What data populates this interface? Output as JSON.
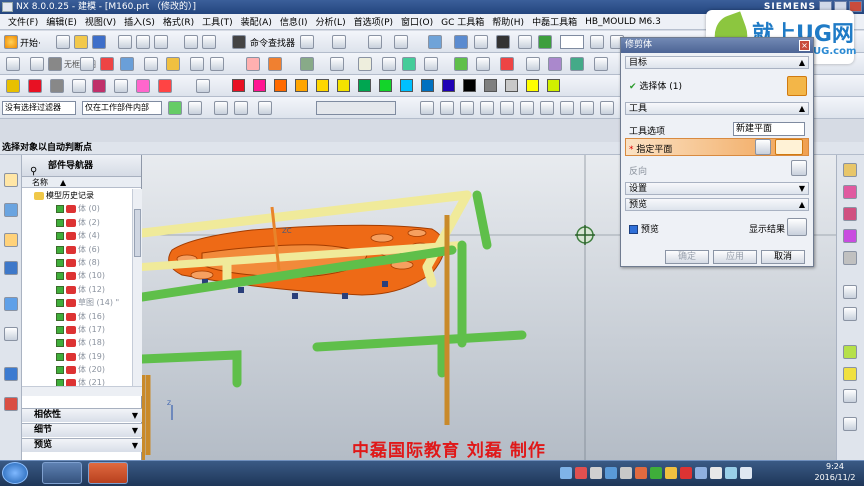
{
  "window": {
    "title": "NX 8.0.0.25 - 建模 - [M160.prt （修改的）]",
    "brand": "SIEMENS"
  },
  "menu": [
    "文件(F)",
    "编辑(E)",
    "视图(V)",
    "插入(S)",
    "格式(R)",
    "工具(T)",
    "装配(A)",
    "信息(I)",
    "分析(L)",
    "首选项(P)",
    "窗口(O)",
    "GC 工具箱",
    "帮助(H)",
    "中磊工具箱",
    "HB_MOULD M6.3"
  ],
  "toolbar": {
    "start_label": "开始·",
    "command_finder": "命令查找器",
    "datum_label": "无框草图",
    "filter_combo": "没有选择过滤器",
    "scope_combo": "仅在工作部件内部",
    "status": "选择对象以自动判断点"
  },
  "logo": {
    "name": "就上UG网",
    "url": "www.9SUG.com"
  },
  "navigator": {
    "title": "部件导航器",
    "col_name": "名称",
    "items": [
      {
        "label": "模型历史记录",
        "indent": 1
      },
      {
        "label": "体 (0)",
        "indent": 2
      },
      {
        "label": "体 (2)",
        "indent": 2
      },
      {
        "label": "体 (4)",
        "indent": 2
      },
      {
        "label": "体 (6)",
        "indent": 2
      },
      {
        "label": "体 (8)",
        "indent": 2
      },
      {
        "label": "体 (10)",
        "indent": 2
      },
      {
        "label": "体 (12)",
        "indent": 2
      },
      {
        "label": "草图 (14) \"",
        "indent": 2
      },
      {
        "label": "体 (16)",
        "indent": 2
      },
      {
        "label": "体 (17)",
        "indent": 2
      },
      {
        "label": "体 (18)",
        "indent": 2
      },
      {
        "label": "体 (19)",
        "indent": 2
      },
      {
        "label": "体 (20)",
        "indent": 2
      },
      {
        "label": "体 (21)",
        "indent": 2
      }
    ],
    "sections": [
      "相依性",
      "细节",
      "预览"
    ]
  },
  "dialog": {
    "title": "修剪体",
    "target_section": "目标",
    "select_body": "选择体 (1)",
    "tool_section": "工具",
    "tool_option_label": "工具选项",
    "tool_option_value": "新建平面",
    "specify_plane": "指定平面",
    "reverse": "反向",
    "settings": "设置",
    "preview_section": "预览",
    "preview_check": "预览",
    "show_result": "显示结果",
    "ok": "确定",
    "apply": "应用",
    "cancel": "取消"
  },
  "caption": "中磊国际教育  刘磊  制作",
  "clock": {
    "time": "9:24",
    "date": "2016/11/2"
  },
  "colors": {
    "swatches": [
      "#e81123",
      "#ff1493",
      "#ff6a00",
      "#ffa500",
      "#ffd700",
      "#f4e200",
      "#00a651",
      "#13d42a",
      "#00c0ff",
      "#0070c0",
      "#1e00b5",
      "#000000",
      "#7f7f7f",
      "#c8c8c8",
      "#ffff00",
      "#d0f000"
    ],
    "model_orange": "#ee6a16",
    "tube_yellow": "#f0ea9a",
    "tube_green": "#5fbf4a",
    "tube_brown": "#c98a2a"
  }
}
